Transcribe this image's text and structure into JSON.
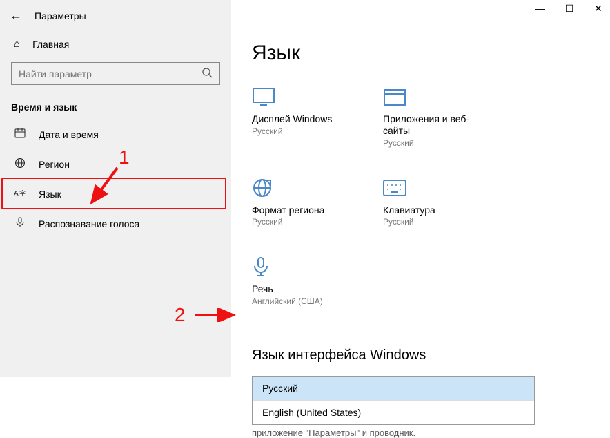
{
  "window": {
    "title": "Параметры"
  },
  "sidebar": {
    "home": "Главная",
    "search_placeholder": "Найти параметр",
    "section": "Время и язык",
    "items": [
      {
        "label": "Дата и время",
        "icon": "calendar-icon"
      },
      {
        "label": "Регион",
        "icon": "globe-icon"
      },
      {
        "label": "Язык",
        "icon": "language-icon"
      },
      {
        "label": "Распознавание голоса",
        "icon": "mic-icon"
      }
    ]
  },
  "main": {
    "heading": "Язык",
    "tiles": [
      {
        "label": "Дисплей Windows",
        "sub": "Русский",
        "icon": "display-icon"
      },
      {
        "label": "Приложения и веб-сайты",
        "sub": "Русский",
        "icon": "apps-icon"
      },
      {
        "label": "Формат региона",
        "sub": "Русский",
        "icon": "region-format-icon"
      },
      {
        "label": "Клавиатура",
        "sub": "Русский",
        "icon": "keyboard-icon"
      },
      {
        "label": "Речь",
        "sub": "Английский (США)",
        "icon": "speech-icon"
      }
    ],
    "interface_heading": "Язык интерфейса Windows",
    "dropdown": {
      "options": [
        {
          "label": "Русский",
          "selected": true
        },
        {
          "label": "English (United States)",
          "selected": false
        }
      ]
    },
    "truncated_text": "приложение \"Параметры\" и проводник."
  },
  "annotations": {
    "n1": "1",
    "n2": "2"
  }
}
